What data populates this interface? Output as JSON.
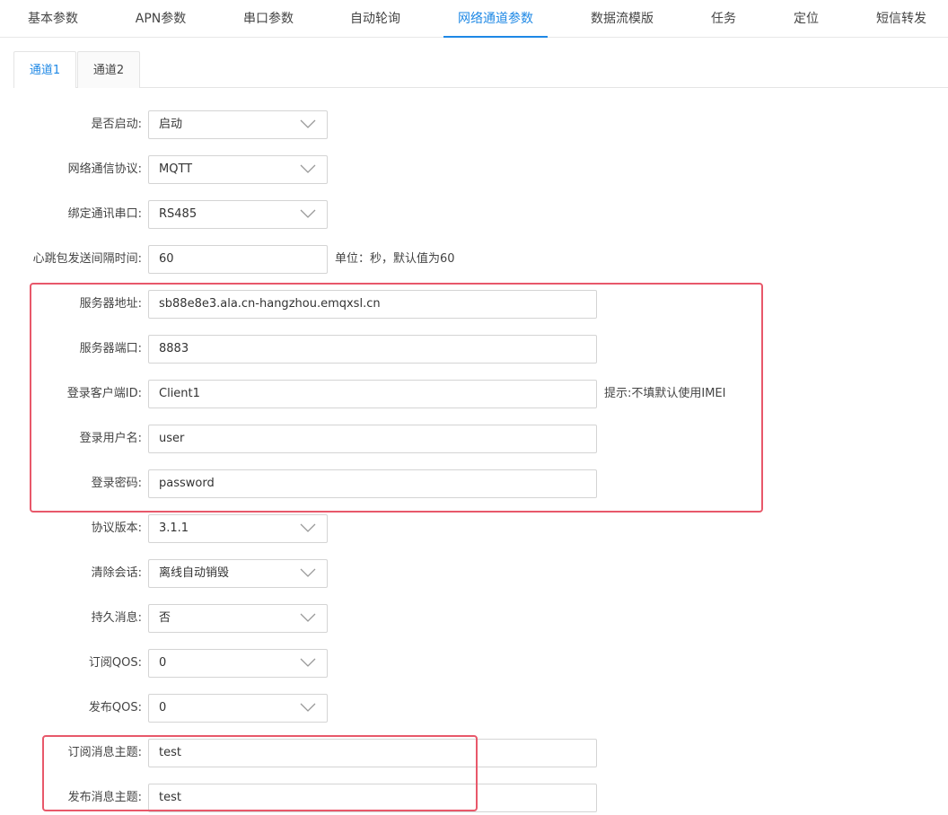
{
  "top_tabs": [
    "基本参数",
    "APN参数",
    "串口参数",
    "自动轮询",
    "网络通道参数",
    "数据流模版",
    "任务",
    "定位",
    "短信转发"
  ],
  "active_top_tab": "网络通道参数",
  "sub_tabs": [
    "通道1",
    "通道2"
  ],
  "active_sub_tab": "通道1",
  "accent_color": "#1e88e5",
  "highlight_color": "#e8586a",
  "form": {
    "enable": {
      "label": "是否启动:",
      "value": "启动"
    },
    "protocol": {
      "label": "网络通信协议:",
      "value": "MQTT"
    },
    "serial": {
      "label": "绑定通讯串口:",
      "value": "RS485"
    },
    "heartbeat": {
      "label": "心跳包发送间隔时间:",
      "value": "60",
      "hint": "单位：秒，默认值为60"
    },
    "server_addr": {
      "label": "服务器地址:",
      "value": "sb88e8e3.ala.cn-hangzhou.emqxsl.cn"
    },
    "server_port": {
      "label": "服务器端口:",
      "value": "8883"
    },
    "client_id": {
      "label": "登录客户端ID:",
      "value": "Client1",
      "hint": "提示:不填默认使用IMEI"
    },
    "username": {
      "label": "登录用户名:",
      "value": "user"
    },
    "password": {
      "label": "登录密码:",
      "value": "password"
    },
    "proto_version": {
      "label": "协议版本:",
      "value": "3.1.1"
    },
    "clean_session": {
      "label": "清除会话:",
      "value": "离线自动销毁"
    },
    "retain": {
      "label": "持久消息:",
      "value": "否"
    },
    "sub_qos": {
      "label": "订阅QOS:",
      "value": "0"
    },
    "pub_qos": {
      "label": "发布QOS:",
      "value": "0"
    },
    "sub_topic": {
      "label": "订阅消息主题:",
      "value": "test"
    },
    "pub_topic": {
      "label": "发布消息主题:",
      "value": "test"
    }
  }
}
